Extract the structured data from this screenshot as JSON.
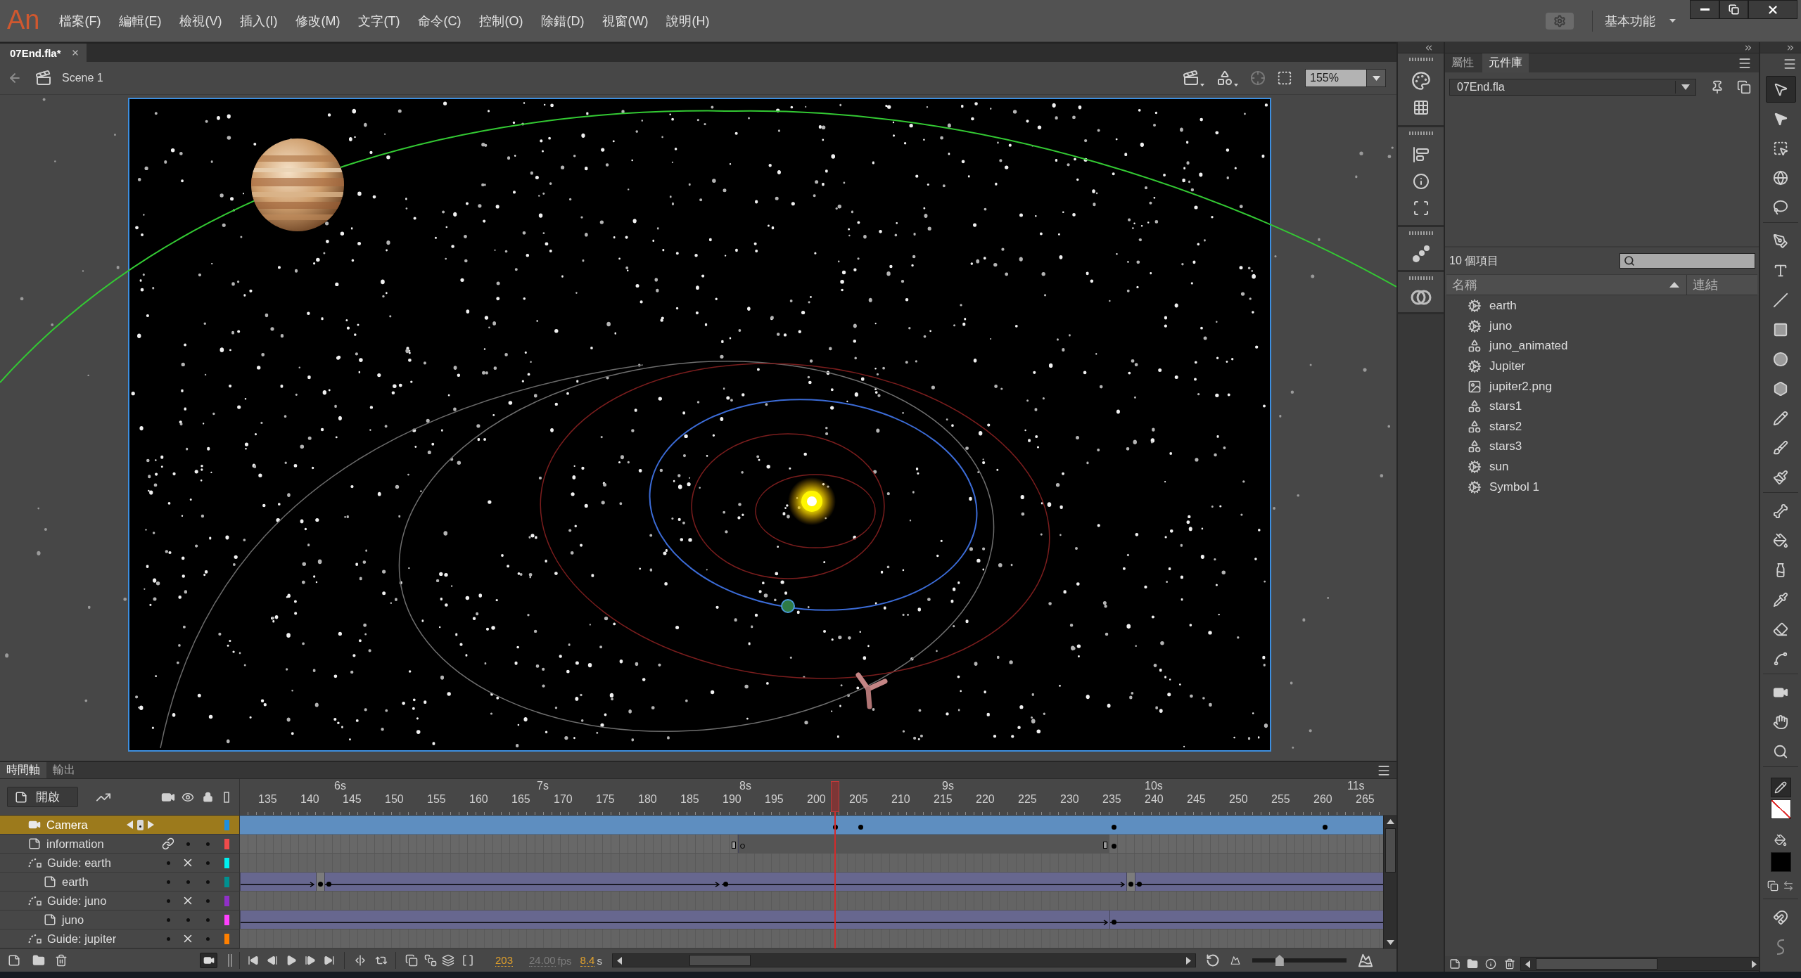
{
  "menu_bar": {
    "logo": "An",
    "menus": [
      "檔案(F)",
      "編輯(E)",
      "檢視(V)",
      "插入(I)",
      "修改(M)",
      "文字(T)",
      "命令(C)",
      "控制(O)",
      "除錯(D)",
      "視窗(W)",
      "說明(H)"
    ],
    "workspace": "基本功能"
  },
  "document_tabs": [
    {
      "label": "07End.fla*",
      "selected": true
    }
  ],
  "edit_bar": {
    "scene": "Scene 1",
    "zoom": "155%"
  },
  "timeline": {
    "tabs": [
      {
        "label": "時間軸",
        "selected": true
      },
      {
        "label": "輸出",
        "selected": false
      }
    ],
    "open_button": "開啟",
    "ruler": {
      "seconds": [
        "6s",
        "7s",
        "8s",
        "9s",
        "10s",
        "11s"
      ],
      "frames": [
        "135",
        "140",
        "145",
        "150",
        "155",
        "160",
        "165",
        "170",
        "175",
        "180",
        "185",
        "190",
        "195",
        "200",
        "205",
        "210",
        "215",
        "220",
        "225",
        "230",
        "235",
        "240",
        "245",
        "250",
        "255",
        "260",
        "265"
      ]
    },
    "layers": [
      {
        "name": "Camera",
        "kind": "camera",
        "selected": true,
        "color": "#1e8fe0"
      },
      {
        "name": "information",
        "kind": "normal",
        "selected": false,
        "attached": true,
        "visible": true,
        "locked": false,
        "color": "#ef4b4b"
      },
      {
        "name": "Guide: earth",
        "kind": "guide",
        "selected": false,
        "attached": false,
        "visible": false,
        "locked": false,
        "color": "#00f0f0",
        "children": [
          {
            "name": "earth",
            "kind": "normal",
            "selected": false,
            "attached": false,
            "visible": true,
            "locked": false,
            "color": "#009090"
          }
        ]
      },
      {
        "name": "Guide: juno",
        "kind": "guide",
        "selected": false,
        "attached": false,
        "visible": false,
        "locked": false,
        "color": "#9030c8",
        "children": [
          {
            "name": "juno",
            "kind": "normal",
            "selected": false,
            "attached": false,
            "visible": true,
            "locked": false,
            "color": "#ff40ff"
          }
        ]
      },
      {
        "name": "Guide: jupiter",
        "kind": "guide",
        "selected": false,
        "attached": false,
        "visible": false,
        "locked": false,
        "color": "#ff8000"
      }
    ],
    "camera_on": true,
    "current_frame": "203",
    "frame_rate": {
      "value": "24.00",
      "unit": "fps",
      "disabled": true
    },
    "elapsed": {
      "value": "8.4",
      "unit": "s",
      "disabled": false
    },
    "zoom_slider": {
      "level": 0.29
    }
  },
  "library_panel": {
    "tabs": [
      {
        "label": "屬性",
        "selected": false
      },
      {
        "label": "元件庫",
        "selected": true
      }
    ],
    "document": "07End.fla",
    "item_count": "10 個項目",
    "columns": [
      {
        "label": "名稱",
        "sorted": true
      },
      {
        "label": "連結",
        "sorted": false
      }
    ],
    "items": [
      {
        "name": "earth",
        "kind": "movieclip",
        "selected": false
      },
      {
        "name": "juno",
        "kind": "movieclip",
        "selected": false
      },
      {
        "name": "juno_animated",
        "kind": "graphic",
        "selected": false
      },
      {
        "name": "Jupiter",
        "kind": "movieclip",
        "selected": false
      },
      {
        "name": "jupiter2.png",
        "kind": "bitmap",
        "selected": false
      },
      {
        "name": "stars1",
        "kind": "graphic",
        "selected": false
      },
      {
        "name": "stars2",
        "kind": "graphic",
        "selected": false
      },
      {
        "name": "stars3",
        "kind": "graphic",
        "selected": false
      },
      {
        "name": "sun",
        "kind": "movieclip",
        "selected": false
      },
      {
        "name": "Symbol 1",
        "kind": "movieclip",
        "selected": false
      }
    ]
  },
  "toolbar": {
    "groups": [
      [
        {
          "kind": "selection",
          "selected": true
        },
        {
          "kind": "subselection",
          "selected": false
        },
        {
          "kind": "transform",
          "selected": false
        },
        {
          "kind": "rotate3d",
          "selected": false
        },
        {
          "kind": "lasso",
          "selected": false
        }
      ],
      [
        {
          "kind": "pen",
          "selected": false
        },
        {
          "kind": "text",
          "selected": false
        },
        {
          "kind": "line",
          "selected": false
        },
        {
          "kind": "rectangle",
          "selected": false
        },
        {
          "kind": "oval",
          "selected": false
        },
        {
          "kind": "polygon",
          "selected": false
        },
        {
          "kind": "pencil",
          "selected": false
        },
        {
          "kind": "brush",
          "selected": false
        },
        {
          "kind": "paintbrush",
          "selected": false
        }
      ],
      [
        {
          "kind": "bone",
          "selected": false
        },
        {
          "kind": "bucket",
          "selected": false
        },
        {
          "kind": "inkbottle",
          "selected": false
        },
        {
          "kind": "eyedropper",
          "selected": false
        },
        {
          "kind": "eraser",
          "selected": false
        },
        {
          "kind": "width",
          "selected": false
        }
      ],
      [
        {
          "kind": "camera",
          "selected": false
        },
        {
          "kind": "hand",
          "selected": false
        },
        {
          "kind": "zoom",
          "selected": false
        }
      ]
    ],
    "swatches": [
      {
        "kind": "stroke",
        "selected": true,
        "empty": true
      },
      {
        "kind": "fill",
        "selected": false,
        "empty": false,
        "color": "#000000"
      }
    ],
    "options": [
      {
        "kind": "snap",
        "on": false
      },
      {
        "kind": "smooth",
        "on": false
      }
    ]
  }
}
